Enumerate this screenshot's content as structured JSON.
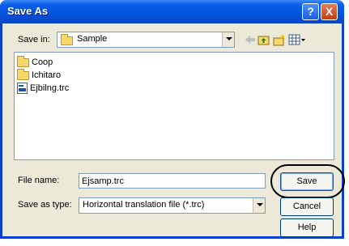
{
  "window": {
    "title": "Save As"
  },
  "titlebar_buttons": {
    "help": "?",
    "close": "X"
  },
  "save_in": {
    "label": "Save in:",
    "value": "Sample"
  },
  "files": [
    {
      "name": "Coop",
      "type": "folder"
    },
    {
      "name": "Ichitaro",
      "type": "folder"
    },
    {
      "name": "Ejbilng.trc",
      "type": "file"
    }
  ],
  "file_name": {
    "label": "File name:",
    "value": "Ejsamp.trc"
  },
  "save_as_type": {
    "label": "Save as type:",
    "value": "Horizontal translation file (*.trc)"
  },
  "buttons": {
    "save": "Save",
    "cancel": "Cancel",
    "help": "Help"
  },
  "colors": {
    "titlebar": "#0452db",
    "dialog_bg": "#ece9d8",
    "field_border": "#7f9db9"
  }
}
